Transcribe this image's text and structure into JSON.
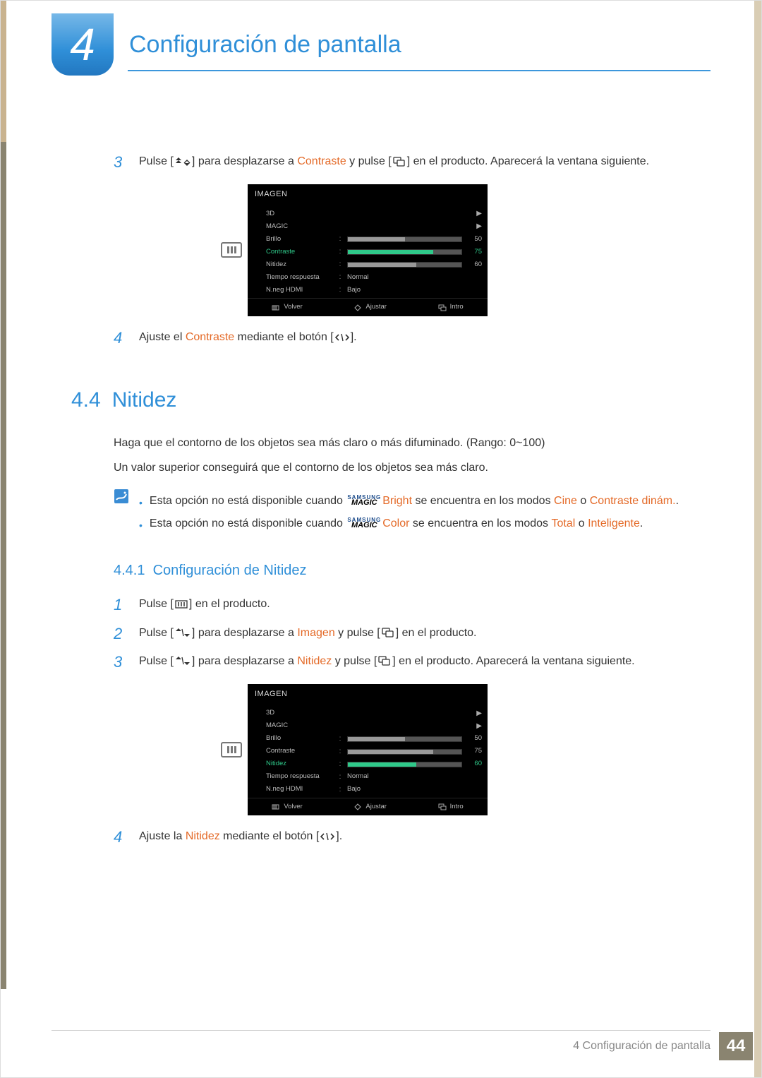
{
  "chapter": {
    "number": "4",
    "title": "Configuración de pantalla"
  },
  "steps_top": {
    "s3_pre": "Pulse [",
    "s3_mid1": "] para desplazarse a ",
    "s3_hl": "Contraste",
    "s3_mid2": " y pulse [",
    "s3_post": "] en el producto. Aparecerá la ventana siguiente.",
    "s4_pre": "Ajuste el ",
    "s4_hl": "Contraste",
    "s4_mid": " mediante el botón [",
    "s4_post": "]."
  },
  "osd1": {
    "title": "IMAGEN",
    "rows": [
      {
        "label": "3D",
        "type": "arrow"
      },
      {
        "label": "MAGIC",
        "type": "arrow"
      },
      {
        "label": "Brillo",
        "type": "bar",
        "value": 50,
        "active": false
      },
      {
        "label": "Contraste",
        "type": "bar",
        "value": 75,
        "active": true
      },
      {
        "label": "Nitidez",
        "type": "bar",
        "value": 60,
        "active": false
      },
      {
        "label": "Tiempo respuesta",
        "type": "text",
        "text": "Normal"
      },
      {
        "label": "N.neg HDMI",
        "type": "text",
        "text": "Bajo"
      }
    ],
    "footer": {
      "back": "Volver",
      "adjust": "Ajustar",
      "enter": "Intro"
    }
  },
  "section": {
    "num": "4.4",
    "title": "Nitidez"
  },
  "para1": "Haga que el contorno de los objetos sea más claro o más difuminado. (Rango: 0~100)",
  "para2": "Un valor superior conseguirá que el contorno de los objetos sea más claro.",
  "notes": {
    "n1_a": "Esta opción no está disponible cuando ",
    "n1_b": "Bright",
    "n1_c": " se encuentra en los modos ",
    "n1_d": "Cine",
    "n1_e": " o ",
    "n1_f": "Contraste dinám.",
    "n2_a": "Esta opción no está disponible cuando ",
    "n2_b": "Color",
    "n2_c": " se encuentra en los modos ",
    "n2_d": "Total",
    "n2_e": " o ",
    "n2_f": "Inteligente"
  },
  "subsection": {
    "num": "4.4.1",
    "title": "Configuración de Nitidez"
  },
  "steps_bot": {
    "s1_pre": "Pulse [",
    "s1_post": "] en el producto.",
    "s2_pre": "Pulse [",
    "s2_mid1": "] para desplazarse a ",
    "s2_hl": "Imagen",
    "s2_mid2": " y pulse [",
    "s2_post": "] en el producto.",
    "s3_pre": "Pulse [",
    "s3_mid1": "] para desplazarse a ",
    "s3_hl": "Nitidez",
    "s3_mid2": " y pulse [",
    "s3_post": "] en el producto. Aparecerá la ventana siguiente.",
    "s4_pre": "Ajuste la ",
    "s4_hl": "Nitidez",
    "s4_mid": " mediante el botón [",
    "s4_post": "]."
  },
  "osd2": {
    "title": "IMAGEN",
    "rows": [
      {
        "label": "3D",
        "type": "arrow"
      },
      {
        "label": "MAGIC",
        "type": "arrow"
      },
      {
        "label": "Brillo",
        "type": "bar",
        "value": 50,
        "active": false
      },
      {
        "label": "Contraste",
        "type": "bar",
        "value": 75,
        "active": false
      },
      {
        "label": "Nitidez",
        "type": "bar",
        "value": 60,
        "active": true
      },
      {
        "label": "Tiempo respuesta",
        "type": "text",
        "text": "Normal"
      },
      {
        "label": "N.neg HDMI",
        "type": "text",
        "text": "Bajo"
      }
    ],
    "footer": {
      "back": "Volver",
      "adjust": "Ajustar",
      "enter": "Intro"
    }
  },
  "footer": {
    "text": "4 Configuración de pantalla",
    "page": "44"
  },
  "magic": {
    "top": "SAMSUNG",
    "bot": "MAGIC"
  }
}
